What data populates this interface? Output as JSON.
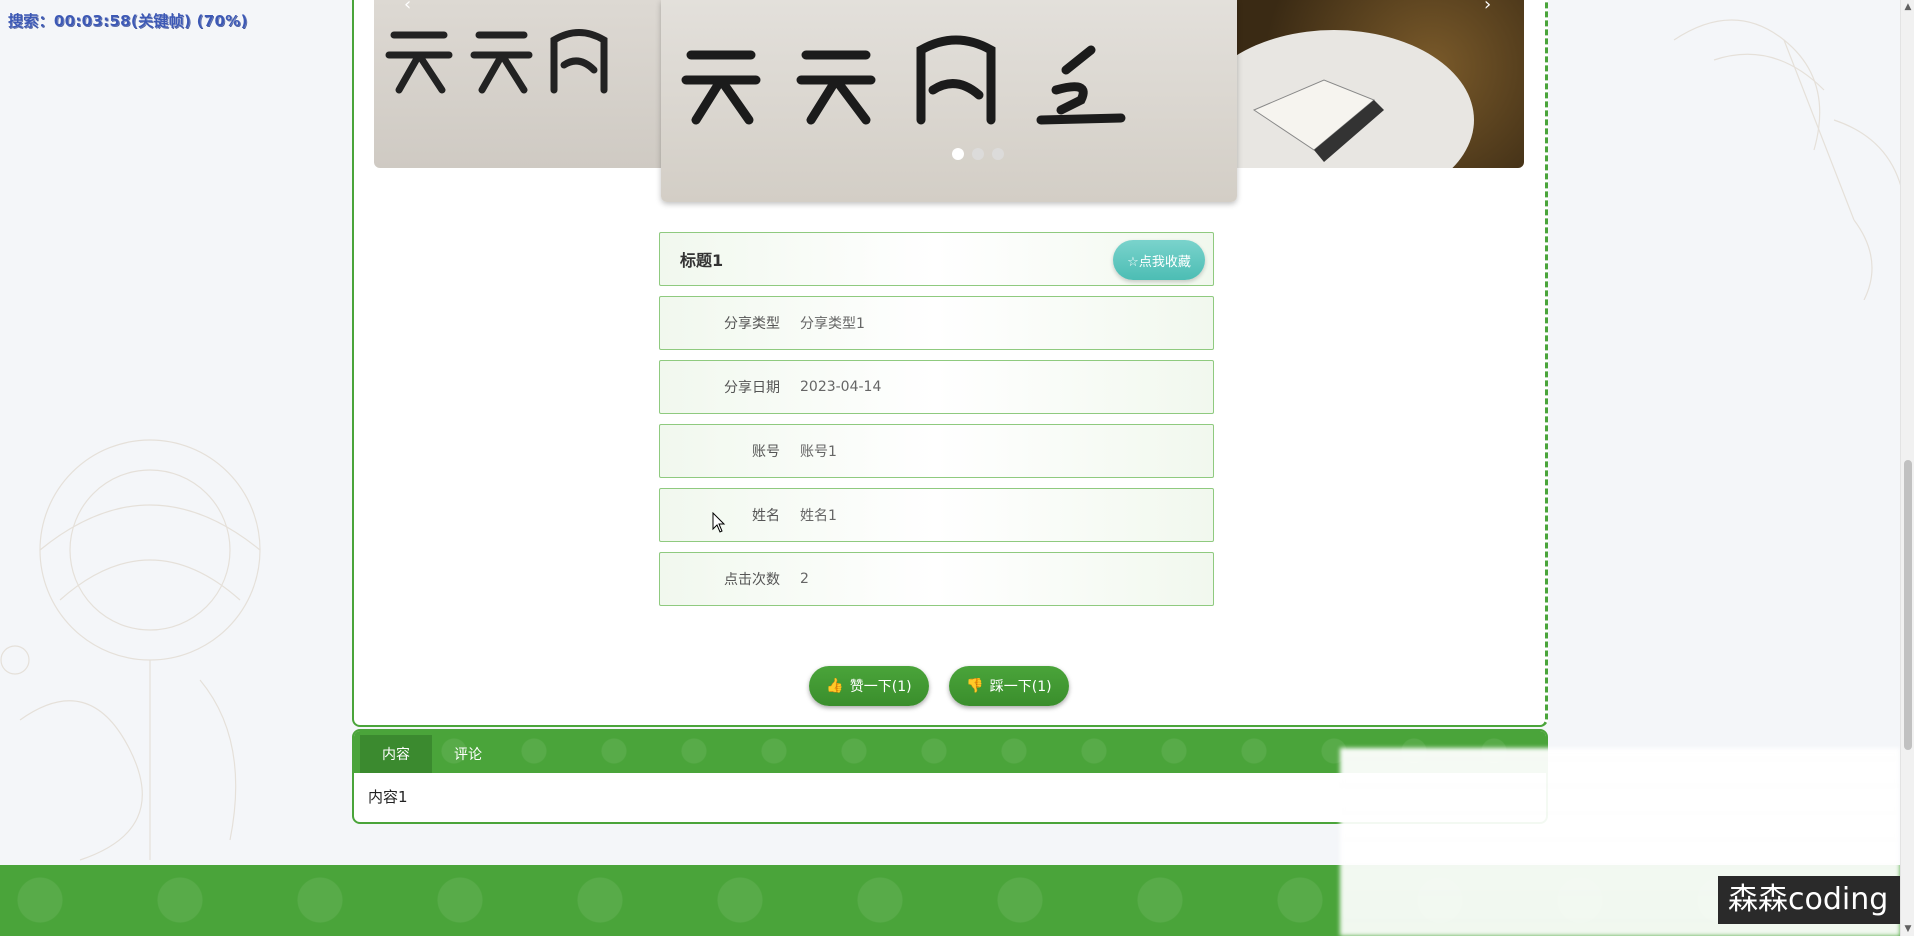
{
  "recording_overlay": "搜索：00:03:58(关键帧) (70%)",
  "carousel": {
    "prev_icon": "chevron-left-icon",
    "next_icon": "chevron-right-icon",
    "dots": 3,
    "active_index": 0
  },
  "detail": {
    "title": "标题1",
    "favorite_label": "☆点我收藏",
    "fields": [
      {
        "label": "分享类型",
        "value": "分享类型1"
      },
      {
        "label": "分享日期",
        "value": "2023-04-14"
      },
      {
        "label": "账号",
        "value": "账号1"
      },
      {
        "label": "姓名",
        "value": "姓名1"
      },
      {
        "label": "点击次数",
        "value": "2"
      }
    ],
    "like_label": "赞一下(1)",
    "dislike_label": "踩一下(1)"
  },
  "tabs": {
    "items": [
      {
        "label": "内容"
      },
      {
        "label": "评论"
      }
    ],
    "active": "内容",
    "content": "内容1"
  },
  "watermark": "森森coding",
  "colors": {
    "primary_green": "#4aa43a",
    "dark_green": "#3b8a2f",
    "teal_button": "#4cbdb4"
  }
}
